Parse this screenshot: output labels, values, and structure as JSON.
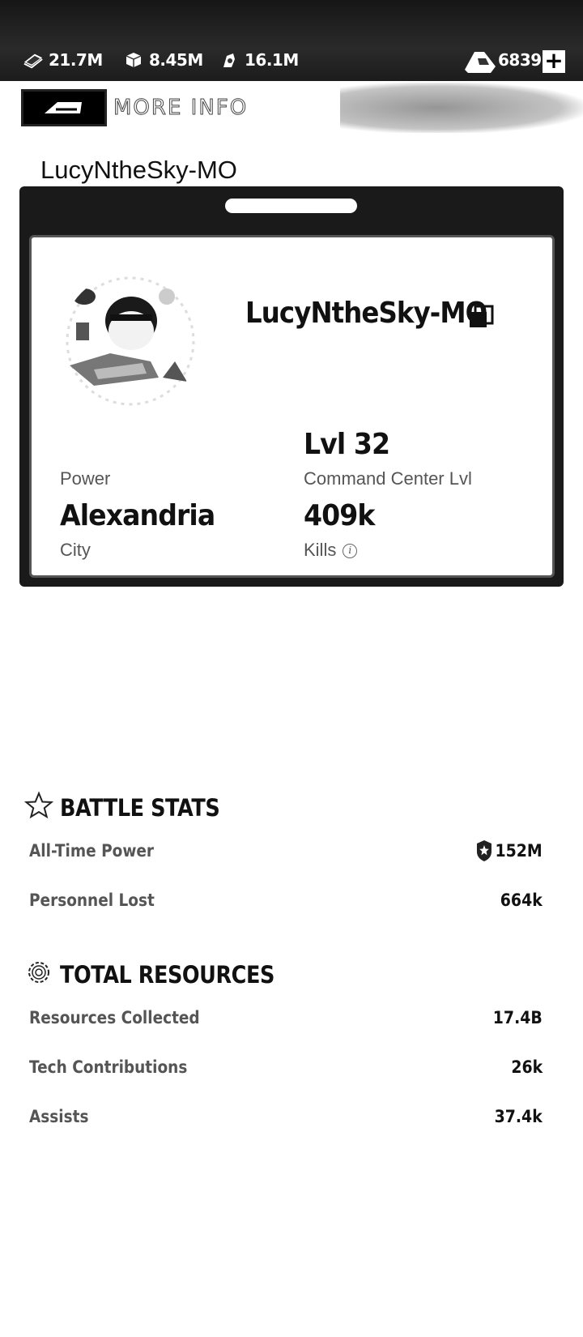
{
  "resources": {
    "cash": {
      "icon": "cash-icon",
      "value": "21.7M"
    },
    "supplies": {
      "icon": "box-icon",
      "value": "8.45M"
    },
    "fuel": {
      "icon": "fuel-icon",
      "value": "16.1M"
    },
    "gold": {
      "icon": "gold-bars-icon",
      "value": "6839"
    },
    "add_label": "+"
  },
  "header": {
    "back_icon": "back-arrow-icon",
    "title": "MORE INFO"
  },
  "player_header": "LucyNtheSky-MO",
  "card": {
    "name": "LucyNtheSky-MO",
    "copy_icon": "copy-icon",
    "power_label": "Power",
    "level_value": "Lvl 32",
    "level_label": "Command Center Lvl",
    "city_value": "Alexandria",
    "city_label": "City",
    "kills_value": "409k",
    "kills_label": "Kills",
    "info_icon": "i"
  },
  "battle_stats": {
    "title": "BATTLE STATS",
    "icon": "star-icon",
    "rows": [
      {
        "label": "All-Time Power",
        "value": "152M",
        "icon": "shield-icon"
      },
      {
        "label": "Personnel Lost",
        "value": "664k"
      }
    ]
  },
  "total_resources": {
    "title": "TOTAL RESOURCES",
    "icon": "gear-icon",
    "rows": [
      {
        "label": "Resources Collected",
        "value": "17.4B"
      },
      {
        "label": "Tech Contributions",
        "value": "26k"
      },
      {
        "label": "Assists",
        "value": "37.4k"
      }
    ]
  }
}
